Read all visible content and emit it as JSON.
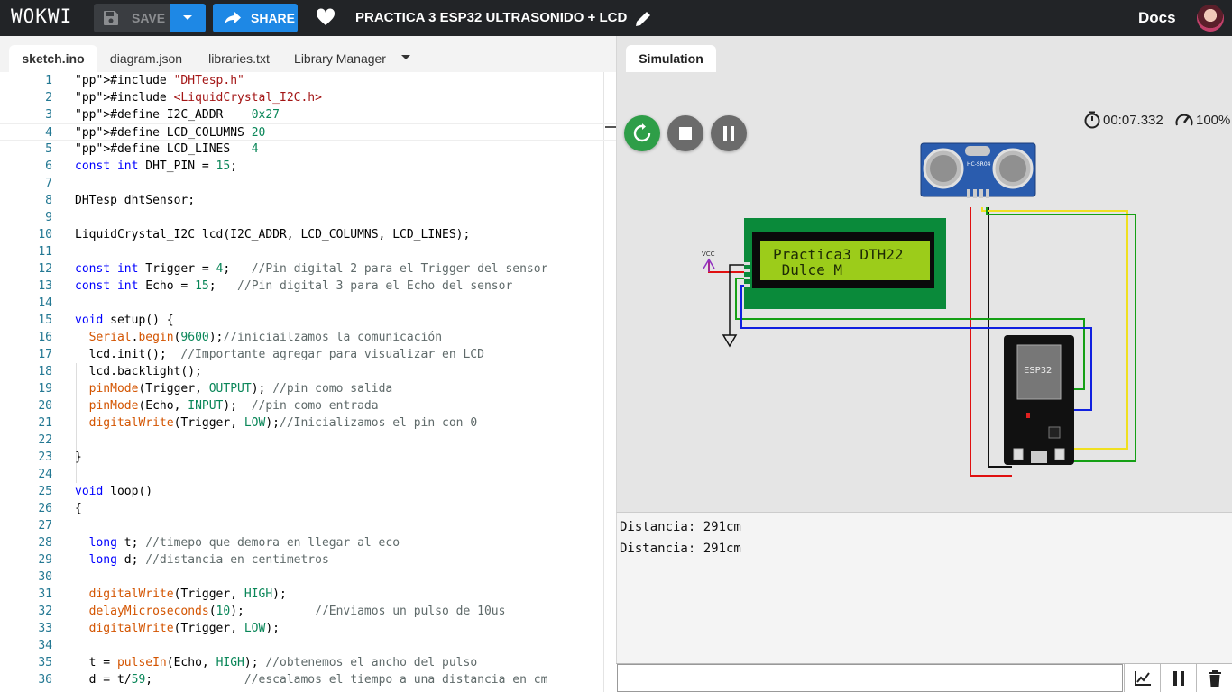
{
  "header": {
    "logo": "WOKWI",
    "save_label": "SAVE",
    "share_label": "SHARE",
    "project_title": "PRACTICA 3 ESP32 ULTRASONIDO + LCD",
    "docs_label": "Docs"
  },
  "editor": {
    "tabs": [
      "sketch.ino",
      "diagram.json",
      "libraries.txt",
      "Library Manager"
    ],
    "active_tab": "sketch.ino",
    "line_numbers": [
      "1",
      "2",
      "3",
      "4",
      "5",
      "6",
      "7",
      "8",
      "9",
      "10",
      "11",
      "12",
      "13",
      "14",
      "15",
      "16",
      "17",
      "18",
      "19",
      "20",
      "21",
      "22",
      "23",
      "24",
      "25",
      "26",
      "27",
      "28",
      "29",
      "30",
      "31",
      "32",
      "33",
      "34",
      "35",
      "36"
    ],
    "lines": [
      "#include \"DHTesp.h\"",
      "#include <LiquidCrystal_I2C.h>",
      "#define I2C_ADDR    0x27",
      "#define LCD_COLUMNS 20",
      "#define LCD_LINES   4",
      "const int DHT_PIN = 15;",
      "",
      "DHTesp dhtSensor;",
      "",
      "LiquidCrystal_I2C lcd(I2C_ADDR, LCD_COLUMNS, LCD_LINES);",
      "",
      "const int Trigger = 4;   //Pin digital 2 para el Trigger del sensor",
      "const int Echo = 15;   //Pin digital 3 para el Echo del sensor",
      "",
      "void setup() {",
      "  Serial.begin(9600);//iniciailzamos la comunicación",
      "  lcd.init();  //Importante agregar para visualizar en LCD",
      "  lcd.backlight();",
      "  pinMode(Trigger, OUTPUT); //pin como salida",
      "  pinMode(Echo, INPUT);  //pin como entrada",
      "  digitalWrite(Trigger, LOW);//Inicializamos el pin con 0",
      "",
      "}",
      "",
      "void loop()",
      "{",
      "",
      "  long t; //timepo que demora en llegar al eco",
      "  long d; //distancia en centimetros",
      "",
      "  digitalWrite(Trigger, HIGH);",
      "  delayMicroseconds(10);          //Enviamos un pulso de 10us",
      "  digitalWrite(Trigger, LOW);",
      "",
      "  t = pulseIn(Echo, HIGH); //obtenemos el ancho del pulso",
      "  d = t/59;             //escalamos el tiempo a una distancia en cm"
    ]
  },
  "simulation": {
    "tab_label": "Simulation",
    "timer": "00:07.332",
    "speed": "100%",
    "lcd_line1": "Practica3 DTH22",
    "lcd_line2": " Dulce M",
    "ultrasonic_label": "HC-SR04",
    "esp32_label": "ESP32",
    "vcc_label": "VCC"
  },
  "serial_monitor": {
    "lines": [
      "Distancia: 291cm",
      "Distancia: 291cm"
    ],
    "input_value": ""
  },
  "icons": {
    "save": "floppy-icon",
    "share": "share-arrow-icon",
    "favorite": "heart-icon",
    "edit": "pencil-icon",
    "restart": "restart-icon",
    "stop": "stop-icon",
    "pause": "pause-icon",
    "timer": "stopwatch-icon",
    "speed": "speedometer-icon",
    "plotter": "chart-icon",
    "delete": "trash-icon"
  },
  "colors": {
    "topbar": "#222427",
    "accent": "#1e88e5",
    "run_green": "#2e9e48",
    "lcd_green": "#9ccc1a"
  }
}
